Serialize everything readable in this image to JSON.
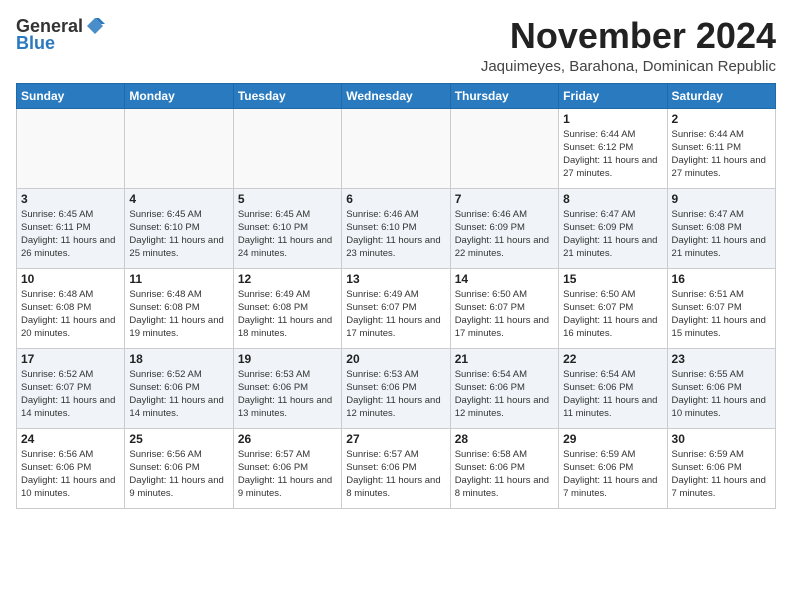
{
  "header": {
    "logo_general": "General",
    "logo_blue": "Blue",
    "month_title": "November 2024",
    "location": "Jaquimeyes, Barahona, Dominican Republic"
  },
  "calendar": {
    "days_of_week": [
      "Sunday",
      "Monday",
      "Tuesday",
      "Wednesday",
      "Thursday",
      "Friday",
      "Saturday"
    ],
    "weeks": [
      [
        {
          "day": "",
          "info": "",
          "empty": true
        },
        {
          "day": "",
          "info": "",
          "empty": true
        },
        {
          "day": "",
          "info": "",
          "empty": true
        },
        {
          "day": "",
          "info": "",
          "empty": true
        },
        {
          "day": "",
          "info": "",
          "empty": true
        },
        {
          "day": "1",
          "info": "Sunrise: 6:44 AM\nSunset: 6:12 PM\nDaylight: 11 hours and 27 minutes.",
          "empty": false
        },
        {
          "day": "2",
          "info": "Sunrise: 6:44 AM\nSunset: 6:11 PM\nDaylight: 11 hours and 27 minutes.",
          "empty": false
        }
      ],
      [
        {
          "day": "3",
          "info": "Sunrise: 6:45 AM\nSunset: 6:11 PM\nDaylight: 11 hours and 26 minutes.",
          "empty": false
        },
        {
          "day": "4",
          "info": "Sunrise: 6:45 AM\nSunset: 6:10 PM\nDaylight: 11 hours and 25 minutes.",
          "empty": false
        },
        {
          "day": "5",
          "info": "Sunrise: 6:45 AM\nSunset: 6:10 PM\nDaylight: 11 hours and 24 minutes.",
          "empty": false
        },
        {
          "day": "6",
          "info": "Sunrise: 6:46 AM\nSunset: 6:10 PM\nDaylight: 11 hours and 23 minutes.",
          "empty": false
        },
        {
          "day": "7",
          "info": "Sunrise: 6:46 AM\nSunset: 6:09 PM\nDaylight: 11 hours and 22 minutes.",
          "empty": false
        },
        {
          "day": "8",
          "info": "Sunrise: 6:47 AM\nSunset: 6:09 PM\nDaylight: 11 hours and 21 minutes.",
          "empty": false
        },
        {
          "day": "9",
          "info": "Sunrise: 6:47 AM\nSunset: 6:08 PM\nDaylight: 11 hours and 21 minutes.",
          "empty": false
        }
      ],
      [
        {
          "day": "10",
          "info": "Sunrise: 6:48 AM\nSunset: 6:08 PM\nDaylight: 11 hours and 20 minutes.",
          "empty": false
        },
        {
          "day": "11",
          "info": "Sunrise: 6:48 AM\nSunset: 6:08 PM\nDaylight: 11 hours and 19 minutes.",
          "empty": false
        },
        {
          "day": "12",
          "info": "Sunrise: 6:49 AM\nSunset: 6:08 PM\nDaylight: 11 hours and 18 minutes.",
          "empty": false
        },
        {
          "day": "13",
          "info": "Sunrise: 6:49 AM\nSunset: 6:07 PM\nDaylight: 11 hours and 17 minutes.",
          "empty": false
        },
        {
          "day": "14",
          "info": "Sunrise: 6:50 AM\nSunset: 6:07 PM\nDaylight: 11 hours and 17 minutes.",
          "empty": false
        },
        {
          "day": "15",
          "info": "Sunrise: 6:50 AM\nSunset: 6:07 PM\nDaylight: 11 hours and 16 minutes.",
          "empty": false
        },
        {
          "day": "16",
          "info": "Sunrise: 6:51 AM\nSunset: 6:07 PM\nDaylight: 11 hours and 15 minutes.",
          "empty": false
        }
      ],
      [
        {
          "day": "17",
          "info": "Sunrise: 6:52 AM\nSunset: 6:07 PM\nDaylight: 11 hours and 14 minutes.",
          "empty": false
        },
        {
          "day": "18",
          "info": "Sunrise: 6:52 AM\nSunset: 6:06 PM\nDaylight: 11 hours and 14 minutes.",
          "empty": false
        },
        {
          "day": "19",
          "info": "Sunrise: 6:53 AM\nSunset: 6:06 PM\nDaylight: 11 hours and 13 minutes.",
          "empty": false
        },
        {
          "day": "20",
          "info": "Sunrise: 6:53 AM\nSunset: 6:06 PM\nDaylight: 11 hours and 12 minutes.",
          "empty": false
        },
        {
          "day": "21",
          "info": "Sunrise: 6:54 AM\nSunset: 6:06 PM\nDaylight: 11 hours and 12 minutes.",
          "empty": false
        },
        {
          "day": "22",
          "info": "Sunrise: 6:54 AM\nSunset: 6:06 PM\nDaylight: 11 hours and 11 minutes.",
          "empty": false
        },
        {
          "day": "23",
          "info": "Sunrise: 6:55 AM\nSunset: 6:06 PM\nDaylight: 11 hours and 10 minutes.",
          "empty": false
        }
      ],
      [
        {
          "day": "24",
          "info": "Sunrise: 6:56 AM\nSunset: 6:06 PM\nDaylight: 11 hours and 10 minutes.",
          "empty": false
        },
        {
          "day": "25",
          "info": "Sunrise: 6:56 AM\nSunset: 6:06 PM\nDaylight: 11 hours and 9 minutes.",
          "empty": false
        },
        {
          "day": "26",
          "info": "Sunrise: 6:57 AM\nSunset: 6:06 PM\nDaylight: 11 hours and 9 minutes.",
          "empty": false
        },
        {
          "day": "27",
          "info": "Sunrise: 6:57 AM\nSunset: 6:06 PM\nDaylight: 11 hours and 8 minutes.",
          "empty": false
        },
        {
          "day": "28",
          "info": "Sunrise: 6:58 AM\nSunset: 6:06 PM\nDaylight: 11 hours and 8 minutes.",
          "empty": false
        },
        {
          "day": "29",
          "info": "Sunrise: 6:59 AM\nSunset: 6:06 PM\nDaylight: 11 hours and 7 minutes.",
          "empty": false
        },
        {
          "day": "30",
          "info": "Sunrise: 6:59 AM\nSunset: 6:06 PM\nDaylight: 11 hours and 7 minutes.",
          "empty": false
        }
      ]
    ]
  }
}
